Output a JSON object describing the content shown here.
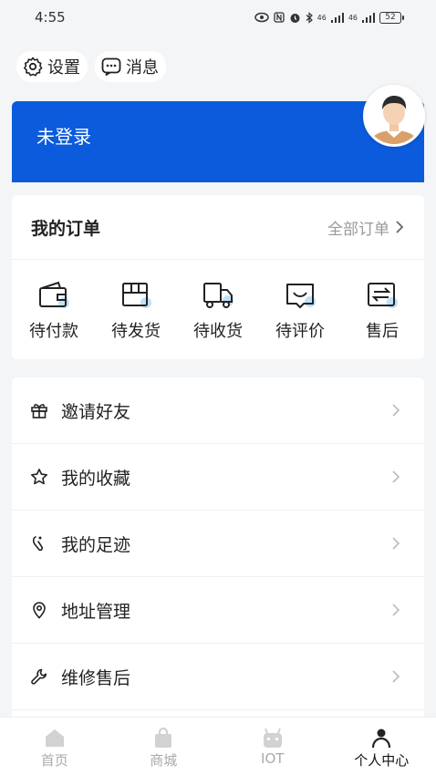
{
  "status_bar": {
    "time": "4:55",
    "signal1": "46",
    "signal2": "46",
    "battery": "52"
  },
  "top_actions": {
    "settings_label": "设置",
    "messages_label": "消息"
  },
  "login": {
    "text": "未登录"
  },
  "orders": {
    "title": "我的订单",
    "all_label": "全部订单",
    "items": [
      {
        "label": "待付款",
        "icon": "wallet-icon"
      },
      {
        "label": "待发货",
        "icon": "package-icon"
      },
      {
        "label": "待收货",
        "icon": "truck-icon"
      },
      {
        "label": "待评价",
        "icon": "review-icon"
      },
      {
        "label": "售后",
        "icon": "exchange-icon"
      }
    ]
  },
  "menu": {
    "items": [
      {
        "label": "邀请好友",
        "icon": "gift-icon"
      },
      {
        "label": "我的收藏",
        "icon": "star-icon"
      },
      {
        "label": "我的足迹",
        "icon": "footprint-icon"
      },
      {
        "label": "地址管理",
        "icon": "location-icon"
      },
      {
        "label": "维修售后",
        "icon": "wrench-icon"
      }
    ]
  },
  "bottom_nav": {
    "items": [
      {
        "label": "首页",
        "icon": "home-icon"
      },
      {
        "label": "商城",
        "icon": "shop-bag-icon"
      },
      {
        "label": "IOT",
        "icon": "robot-icon"
      },
      {
        "label": "个人中心",
        "icon": "person-icon"
      }
    ],
    "active": "个人中心"
  },
  "colors": {
    "accent": "#0b5bdc",
    "badge": "#bfe0f7",
    "inactive_nav": "#aaaaaa"
  }
}
